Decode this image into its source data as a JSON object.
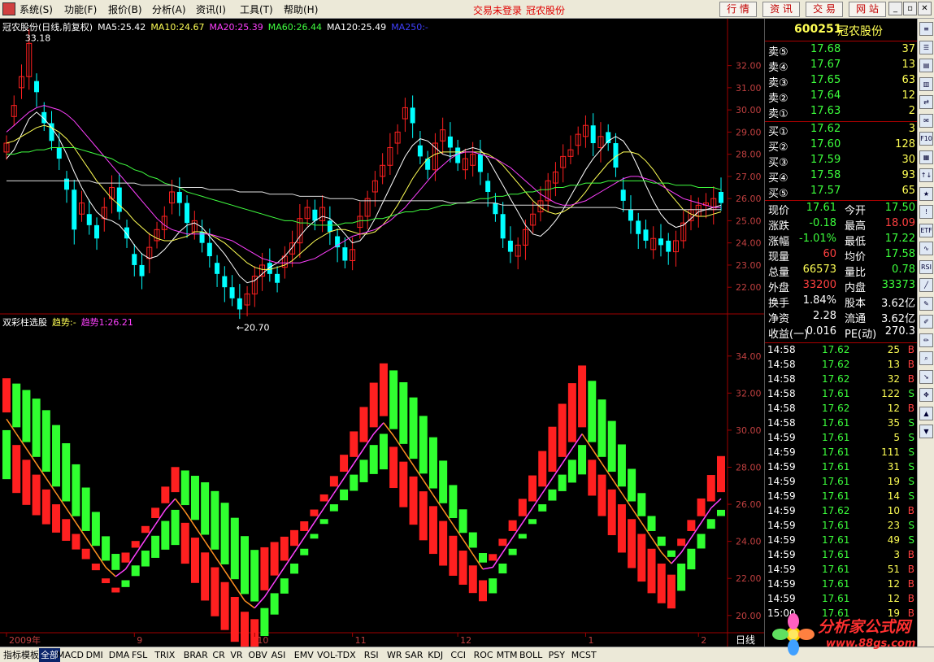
{
  "menu": {
    "items": [
      "系统(S)",
      "功能(F)",
      "报价(B)",
      "分析(A)",
      "资讯(I)",
      "工具(T)",
      "帮助(H)"
    ],
    "status_left": "交易未登录",
    "status_right": "冠农股份",
    "buttons": [
      "行 情",
      "资 讯",
      "交 易",
      "网 站"
    ]
  },
  "price_legend": [
    {
      "text": "冠农股份(日线,前复权)",
      "color": "#ffffff"
    },
    {
      "text": "MA5:25.42",
      "color": "#ffffff"
    },
    {
      "text": "MA10:24.67",
      "color": "#ffff55"
    },
    {
      "text": "MA20:25.39",
      "color": "#ff40ff"
    },
    {
      "text": "MA60:26.44",
      "color": "#40ff40"
    },
    {
      "text": "MA120:25.49",
      "color": "#ffffff"
    },
    {
      "text": "MA250:-",
      "color": "#4040ff"
    }
  ],
  "indicator_legend": [
    {
      "text": "双彩柱选股",
      "color": "#ffffff"
    },
    {
      "text": "趋势:-",
      "color": "#ffff55"
    },
    {
      "text": "趋势1:26.21",
      "color": "#ff40ff"
    }
  ],
  "chart_data": [
    {
      "type": "candlestick",
      "title": "冠农股份(日线,前复权)",
      "y_ticks": [
        "32.00",
        "31.00",
        "30.00",
        "29.00",
        "28.00",
        "27.00",
        "26.00",
        "25.00",
        "24.00",
        "23.00",
        "22.00"
      ],
      "ylim": [
        21.2,
        33.6
      ],
      "annotations": [
        {
          "text": "33.18",
          "value": 33.18
        },
        {
          "text": "←20.70",
          "value": 20.7
        }
      ],
      "series": [
        {
          "name": "MA5",
          "values": [
            27.8,
            28.2,
            28.9,
            29.6,
            29.9,
            29.6,
            29.2,
            28.7,
            28.0,
            27.2,
            26.5,
            25.9,
            25.4,
            25.1,
            25.0,
            24.8,
            24.4,
            23.9,
            23.5,
            23.3,
            23.4,
            23.7,
            24.1,
            24.5,
            24.8,
            24.9,
            24.7,
            24.3,
            23.9,
            23.5,
            23.0,
            22.5,
            22.2,
            22.3,
            22.6,
            22.9,
            23.1,
            23.4,
            23.8,
            24.3,
            24.7,
            25.0,
            25.2,
            25.1,
            24.8,
            24.4,
            24.0,
            24.1,
            24.5,
            25.1,
            25.8,
            26.5,
            27.2,
            27.9,
            28.4,
            28.7,
            28.6,
            28.3,
            28.0,
            27.9,
            28.0,
            28.2,
            28.3,
            28.2,
            27.8,
            27.2,
            26.6,
            26.0,
            25.4,
            24.8,
            24.4,
            24.3,
            24.6,
            25.0,
            25.5,
            26.1,
            26.7,
            27.3,
            27.8,
            28.2,
            28.6,
            28.8,
            28.6,
            28.1,
            27.4,
            26.6,
            25.9,
            25.3,
            24.9,
            24.7,
            24.8,
            25.1,
            25.4,
            25.5,
            25.6,
            25.7
          ]
        },
        {
          "name": "MA10",
          "values": [
            28.5,
            28.6,
            28.8,
            29.0,
            29.2,
            29.3,
            29.2,
            29.0,
            28.7,
            28.3,
            27.8,
            27.3,
            26.8,
            26.4,
            26.0,
            25.7,
            25.4,
            25.0,
            24.7,
            24.4,
            24.2,
            24.1,
            24.1,
            24.2,
            24.3,
            24.5,
            24.5,
            24.4,
            24.2,
            24.0,
            23.7,
            23.4,
            23.1,
            22.9,
            22.8,
            22.8,
            22.9,
            23.0,
            23.2,
            23.5,
            23.8,
            24.1,
            24.3,
            24.5,
            24.6,
            24.6,
            24.5,
            24.4,
            24.4,
            24.5,
            24.8,
            25.2,
            25.7,
            26.3,
            26.9,
            27.4,
            27.8,
            28.0,
            28.1,
            28.1,
            28.1,
            28.1,
            28.1,
            28.1,
            28.0,
            27.8,
            27.5,
            27.1,
            26.7,
            26.3,
            25.9,
            25.6,
            25.4,
            25.3,
            25.4,
            25.6,
            25.9,
            26.3,
            26.8,
            27.2,
            27.6,
            27.9,
            28.1,
            28.1,
            28.0,
            27.7,
            27.3,
            26.8,
            26.3,
            25.9,
            25.5,
            25.3,
            25.2,
            25.2,
            25.3,
            25.4
          ]
        },
        {
          "name": "MA20",
          "values": [
            29.0,
            29.3,
            29.6,
            29.9,
            30.1,
            30.2,
            30.1,
            30.0,
            29.8,
            29.5,
            29.1,
            28.7,
            28.3,
            27.9,
            27.5,
            27.1,
            26.7,
            26.3,
            25.9,
            25.5,
            25.1,
            24.8,
            24.6,
            24.5,
            24.4,
            24.4,
            24.4,
            24.4,
            24.3,
            24.2,
            24.1,
            23.9,
            23.7,
            23.5,
            23.3,
            23.2,
            23.1,
            23.1,
            23.1,
            23.1,
            23.2,
            23.3,
            23.5,
            23.7,
            23.9,
            24.1,
            24.3,
            24.4,
            24.5,
            24.6,
            24.8,
            25.0,
            25.3,
            25.6,
            26.0,
            26.4,
            26.8,
            27.2,
            27.5,
            27.8,
            28.0,
            28.1,
            28.1,
            28.0,
            27.9,
            27.8,
            27.6,
            27.4,
            27.1,
            26.8,
            26.5,
            26.2,
            26.0,
            25.8,
            25.7,
            25.7,
            25.8,
            25.9,
            26.1,
            26.3,
            26.5,
            26.7,
            26.9,
            27.0,
            27.0,
            26.9,
            26.8,
            26.6,
            26.4,
            26.2,
            26.0,
            25.9,
            25.8,
            25.7,
            25.6,
            25.6
          ]
        },
        {
          "name": "MA60",
          "values": [
            28.0,
            28.0,
            28.1,
            28.1,
            28.2,
            28.2,
            28.3,
            28.3,
            28.3,
            28.3,
            28.2,
            28.1,
            28.0,
            27.9,
            27.8,
            27.6,
            27.5,
            27.3,
            27.2,
            27.0,
            26.9,
            26.7,
            26.6,
            26.5,
            26.3,
            26.2,
            26.1,
            26.0,
            25.9,
            25.8,
            25.7,
            25.6,
            25.5,
            25.4,
            25.3,
            25.2,
            25.1,
            25.0,
            25.0,
            24.9,
            24.9,
            24.8,
            24.8,
            24.8,
            24.8,
            24.9,
            24.9,
            25.0,
            25.0,
            25.1,
            25.1,
            25.2,
            25.3,
            25.4,
            25.4,
            25.5,
            25.5,
            25.6,
            25.7,
            25.7,
            25.8,
            25.8,
            25.9,
            26.0,
            26.0,
            26.1,
            26.1,
            26.2,
            26.2,
            26.3,
            26.3,
            26.4,
            26.4,
            26.5,
            26.5,
            26.6,
            26.6,
            26.7,
            26.7,
            26.7,
            26.8,
            26.8,
            26.8,
            26.8,
            26.8,
            26.8,
            26.7,
            26.7,
            26.7,
            26.6,
            26.6,
            26.6,
            26.5,
            26.5,
            26.5,
            26.4
          ]
        },
        {
          "name": "MA120",
          "values": [
            26.8,
            26.8,
            26.8,
            26.8,
            26.8,
            26.8,
            26.8,
            26.8,
            26.8,
            26.8,
            26.8,
            26.8,
            26.7,
            26.7,
            26.7,
            26.7,
            26.7,
            26.7,
            26.6,
            26.6,
            26.6,
            26.6,
            26.6,
            26.5,
            26.5,
            26.5,
            26.5,
            26.4,
            26.4,
            26.4,
            26.4,
            26.3,
            26.3,
            26.3,
            26.3,
            26.2,
            26.2,
            26.2,
            26.2,
            26.1,
            26.1,
            26.1,
            26.1,
            26.0,
            26.0,
            26.0,
            26.0,
            25.9,
            25.9,
            25.9,
            25.9,
            25.9,
            25.9,
            25.9,
            25.9,
            25.9,
            25.9,
            25.9,
            25.9,
            25.8,
            25.8,
            25.8,
            25.8,
            25.8,
            25.8,
            25.8,
            25.7,
            25.7,
            25.7,
            25.7,
            25.7,
            25.7,
            25.7,
            25.6,
            25.6,
            25.6,
            25.6,
            25.6,
            25.6,
            25.6,
            25.6,
            25.6,
            25.5,
            25.5,
            25.5,
            25.5,
            25.5,
            25.5,
            25.5,
            25.5,
            25.5,
            25.5,
            25.5,
            25.5,
            25.5,
            25.5
          ]
        }
      ],
      "closes": [
        28.5,
        30.2,
        31.5,
        33.0,
        30.8,
        29.4,
        28.6,
        27.8,
        26.4,
        24.6,
        25.8,
        24.8,
        24.2,
        25.6,
        26.5,
        25.4,
        24.2,
        23.0,
        22.5,
        23.8,
        24.6,
        25.2,
        26.3,
        25.8,
        24.9,
        25.0,
        24.0,
        23.4,
        22.6,
        22.0,
        21.5,
        21.0,
        21.7,
        22.5,
        23.0,
        22.6,
        22.2,
        23.4,
        24.0,
        25.1,
        25.6,
        25.0,
        25.6,
        24.5,
        23.8,
        23.2,
        23.7,
        25.2,
        26.0,
        26.8,
        27.5,
        28.3,
        29.0,
        30.1,
        29.4,
        27.9,
        27.3,
        28.5,
        29.1,
        28.3,
        27.6,
        27.8,
        28.0,
        27.2,
        26.3,
        25.3,
        24.2,
        23.6,
        23.9,
        24.6,
        25.3,
        25.9,
        26.8,
        27.2,
        27.9,
        28.2,
        28.9,
        29.3,
        28.5,
        28.8,
        28.5,
        27.4,
        25.9,
        25.0,
        24.4,
        24.1,
        24.2,
        23.9,
        23.6,
        24.1,
        24.9,
        25.5,
        25.7,
        25.8,
        26.0,
        25.8
      ],
      "x_labels": [
        {
          "text": "2009年",
          "index": 0
        },
        {
          "text": "9",
          "index": 17
        },
        {
          "text": "10",
          "index": 33
        },
        {
          "text": "11",
          "index": 46
        },
        {
          "text": "12",
          "index": 60
        },
        {
          "text": "1",
          "index": 77
        },
        {
          "text": "2",
          "index": 92
        }
      ]
    },
    {
      "type": "bar",
      "title": "双彩柱选股",
      "y_ticks": [
        "34.00",
        "32.00",
        "30.00",
        "28.00",
        "26.00",
        "24.00",
        "22.00",
        "20.00"
      ],
      "ylim": [
        19.2,
        35.0
      ],
      "trend_line": [
        30.6,
        29.8,
        29.0,
        28.2,
        27.4,
        26.6,
        25.8,
        25.0,
        24.2,
        23.4,
        22.6,
        22.1,
        22.5,
        23.3,
        24.1,
        24.9,
        25.7,
        26.3,
        25.6,
        24.8,
        24.0,
        23.2,
        22.4,
        21.6,
        20.8,
        20.4,
        21.0,
        21.8,
        22.6,
        23.4,
        24.2,
        25.0,
        25.8,
        26.6,
        27.4,
        28.2,
        29.0,
        29.8,
        30.4,
        29.7,
        28.9,
        28.1,
        27.3,
        26.5,
        25.7,
        24.9,
        24.1,
        23.3,
        22.5,
        22.6,
        23.4,
        24.2,
        25.0,
        25.8,
        26.6,
        27.4,
        28.2,
        29.0,
        29.8,
        29.0,
        28.2,
        27.4,
        26.6,
        25.8,
        25.0,
        24.2,
        23.4,
        22.8,
        23.4,
        24.2,
        25.0,
        25.8,
        26.3
      ]
    }
  ],
  "quote": {
    "code": "600251",
    "name": "冠农股份",
    "asks": [
      [
        "卖⑤",
        "17.68",
        "37"
      ],
      [
        "卖④",
        "17.67",
        "13"
      ],
      [
        "卖③",
        "17.65",
        "63"
      ],
      [
        "卖②",
        "17.64",
        "12"
      ],
      [
        "卖①",
        "17.63",
        "2"
      ]
    ],
    "bids": [
      [
        "买①",
        "17.62",
        "3"
      ],
      [
        "买②",
        "17.60",
        "128"
      ],
      [
        "买③",
        "17.59",
        "30"
      ],
      [
        "买④",
        "17.58",
        "93"
      ],
      [
        "买⑤",
        "17.57",
        "65"
      ]
    ],
    "stats": [
      [
        {
          "t": "现价",
          "c": "#ffffff"
        },
        {
          "t": "17.61",
          "c": "#3cff3c"
        },
        {
          "t": "今开",
          "c": "#ffffff"
        },
        {
          "t": "17.50",
          "c": "#3cff3c"
        }
      ],
      [
        {
          "t": "涨跌",
          "c": "#ffffff"
        },
        {
          "t": "-0.18",
          "c": "#3cff3c"
        },
        {
          "t": "最高",
          "c": "#ffffff"
        },
        {
          "t": "18.09",
          "c": "#ff4040"
        }
      ],
      [
        {
          "t": "涨幅",
          "c": "#ffffff"
        },
        {
          "t": "-1.01%",
          "c": "#3cff3c"
        },
        {
          "t": "最低",
          "c": "#ffffff"
        },
        {
          "t": "17.22",
          "c": "#3cff3c"
        }
      ],
      [
        {
          "t": "现量",
          "c": "#ffffff"
        },
        {
          "t": "60",
          "c": "#ff4040"
        },
        {
          "t": "均价",
          "c": "#ffffff"
        },
        {
          "t": "17.58",
          "c": "#3cff3c"
        }
      ],
      [
        {
          "t": "总量",
          "c": "#ffffff"
        },
        {
          "t": "66573",
          "c": "#ffff55"
        },
        {
          "t": "量比",
          "c": "#ffffff"
        },
        {
          "t": "0.78",
          "c": "#3cff3c"
        }
      ],
      [
        {
          "t": "外盘",
          "c": "#ffffff"
        },
        {
          "t": "33200",
          "c": "#ff4040"
        },
        {
          "t": "内盘",
          "c": "#ffffff"
        },
        {
          "t": "33373",
          "c": "#3cff3c"
        }
      ],
      [
        {
          "t": "换手",
          "c": "#ffffff"
        },
        {
          "t": "1.84%",
          "c": "#ffffff"
        },
        {
          "t": "股本",
          "c": "#ffffff"
        },
        {
          "t": "3.62亿",
          "c": "#ffffff"
        }
      ],
      [
        {
          "t": "净资",
          "c": "#ffffff"
        },
        {
          "t": "2.28",
          "c": "#ffffff"
        },
        {
          "t": "流通",
          "c": "#ffffff"
        },
        {
          "t": "3.62亿",
          "c": "#ffffff"
        }
      ],
      [
        {
          "t": "收益(一)",
          "c": "#ffffff"
        },
        {
          "t": "0.016",
          "c": "#ffffff"
        },
        {
          "t": "PE(动)",
          "c": "#ffffff"
        },
        {
          "t": "270.3",
          "c": "#ffffff"
        }
      ]
    ],
    "ticks": [
      [
        "14:58",
        "17.62",
        "25",
        "B"
      ],
      [
        "14:58",
        "17.62",
        "13",
        "B"
      ],
      [
        "14:58",
        "17.62",
        "32",
        "B"
      ],
      [
        "14:58",
        "17.61",
        "122",
        "S"
      ],
      [
        "14:58",
        "17.62",
        "12",
        "B"
      ],
      [
        "14:58",
        "17.61",
        "35",
        "S"
      ],
      [
        "14:59",
        "17.61",
        "5",
        "S"
      ],
      [
        "14:59",
        "17.61",
        "111",
        "S"
      ],
      [
        "14:59",
        "17.61",
        "31",
        "S"
      ],
      [
        "14:59",
        "17.61",
        "19",
        "S"
      ],
      [
        "14:59",
        "17.61",
        "14",
        "S"
      ],
      [
        "14:59",
        "17.62",
        "10",
        "B"
      ],
      [
        "14:59",
        "17.61",
        "23",
        "S"
      ],
      [
        "14:59",
        "17.61",
        "49",
        "S"
      ],
      [
        "14:59",
        "17.61",
        "3",
        "B"
      ],
      [
        "14:59",
        "17.61",
        "51",
        "B"
      ],
      [
        "14:59",
        "17.61",
        "12",
        "B"
      ],
      [
        "14:59",
        "17.61",
        "12",
        "B"
      ],
      [
        "15:00",
        "17.61",
        "19",
        "B"
      ]
    ]
  },
  "colors": {
    "up": "#ff2020",
    "down": "#30ff30",
    "cyan": "#00ffff",
    "grid": "#800000"
  },
  "period_label": "日线",
  "bottom_tabs": [
    "指标",
    "模板",
    "全部",
    "MACD",
    "DMI",
    "DMA",
    "FSL",
    "TRIX",
    "BRAR",
    "CR",
    "VR",
    "OBV",
    "ASI",
    "EMV",
    "VOL-TDX",
    "RSI",
    "WR",
    "SAR",
    "KDJ",
    "CCI",
    "ROC",
    "MTM",
    "BOLL",
    "PSY",
    "MCST"
  ],
  "watermark": {
    "text": "分析家公式网",
    "url": "www.88gs.com"
  },
  "toolbar_icons": [
    "menu-icon",
    "list-icon",
    "chart-icon",
    "kline-icon",
    "compare-icon",
    "news-icon",
    "f10-icon",
    "report-icon",
    "rank-icon",
    "hot-icon",
    "warn-icon",
    "etf-icon",
    "wave-icon",
    "rsi-icon",
    "line-icon",
    "tool-icon",
    "draw-icon",
    "pen-icon",
    "zoom-icon",
    "arrow-icon",
    "move-icon",
    "up-icon",
    "down-icon"
  ]
}
